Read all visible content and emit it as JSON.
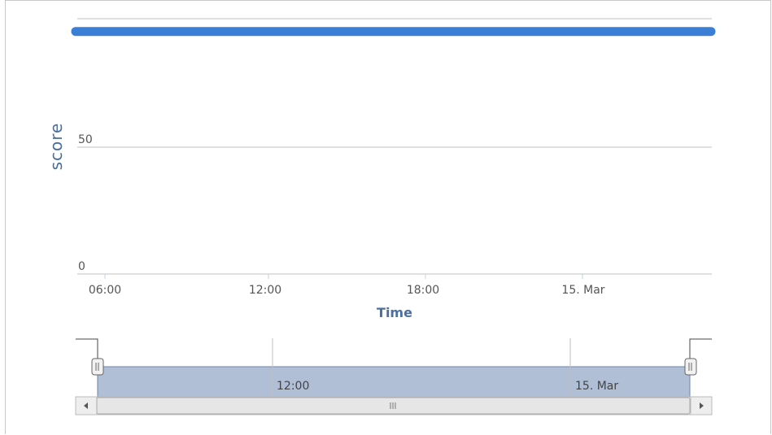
{
  "chart_data": {
    "type": "line",
    "title": "",
    "xlabel": "Time",
    "ylabel": "score",
    "x_ticks": [
      "06:00",
      "12:00",
      "18:00",
      "15. Mar"
    ],
    "y_ticks": [
      0,
      50
    ],
    "ylim": [
      0,
      100
    ],
    "xlim": [
      "14 Mar 05:00",
      "15 Mar 04:30"
    ],
    "series": [
      {
        "x": [
          "14 Mar 05:00",
          "15 Mar 04:30"
        ],
        "values": [
          95,
          95
        ]
      }
    ],
    "series_color": "#3a7fd5",
    "grid": true,
    "navigator": {
      "x_ticks": [
        "12:00",
        "15. Mar"
      ],
      "range": [
        "14 Mar 05:00",
        "15 Mar 04:30"
      ],
      "handle_left": "||",
      "handle_right": "||",
      "scroll_left_icon": "arrow-left-icon",
      "scroll_right_icon": "arrow-right-icon",
      "scroll_grip": "III"
    }
  }
}
